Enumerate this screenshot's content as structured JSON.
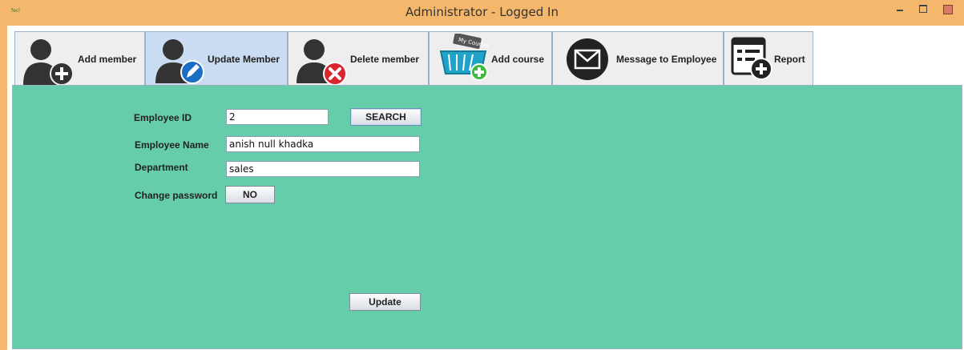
{
  "window": {
    "title": "Administrator - Logged In",
    "app_icon_text": "fecl"
  },
  "tabs": [
    {
      "label": "Add member",
      "icon": "user-add-icon"
    },
    {
      "label": "Update Member",
      "icon": "user-edit-icon",
      "active": true
    },
    {
      "label": "Delete member",
      "icon": "user-delete-icon"
    },
    {
      "label": "Add course",
      "icon": "course-basket-add-icon"
    },
    {
      "label": "Message to Employee",
      "icon": "envelope-icon"
    },
    {
      "label": "Report",
      "icon": "report-add-icon"
    }
  ],
  "course_badge": "My Courses",
  "form": {
    "employee_id_label": "Employee ID",
    "employee_id_value": "2",
    "search_label": "SEARCH",
    "employee_name_label": "Employee Name",
    "employee_name_value": "anish null khadka",
    "department_label": "Department",
    "department_value": "sales",
    "change_password_label": "Change password",
    "change_password_value": "NO",
    "update_label": "Update"
  },
  "colors": {
    "titlebar": "#f4b76b",
    "panel": "#66cdaa",
    "active_tab": "#c9dcf1"
  }
}
